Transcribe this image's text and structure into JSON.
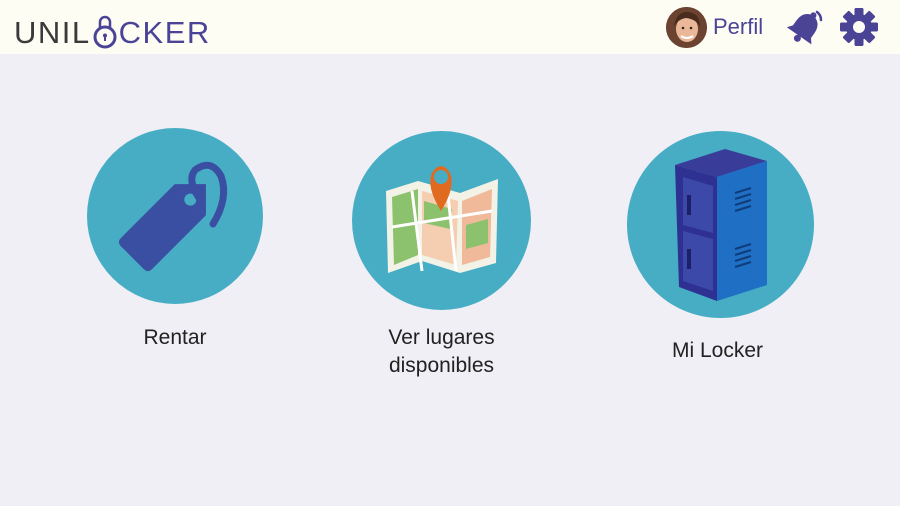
{
  "header": {
    "logo_prefix": "UNIL",
    "logo_suffix": "CKER",
    "profile_label": "Perfil"
  },
  "icons": {
    "logo": "padlock-o-icon",
    "avatar": "user-avatar",
    "bell": "bell-icon",
    "settings": "gear-icon"
  },
  "tiles": [
    {
      "label": "Rentar",
      "icon": "tag-icon"
    },
    {
      "label": "Ver lugares\ndisponibles",
      "icon": "map-pin-icon"
    },
    {
      "label": "Mi Locker",
      "icon": "locker-icon"
    }
  ],
  "colors": {
    "brand_purple": "#4a4396",
    "circle": "#47adc4",
    "header_bg": "#fdfdf4",
    "page_bg": "#efeff5"
  }
}
